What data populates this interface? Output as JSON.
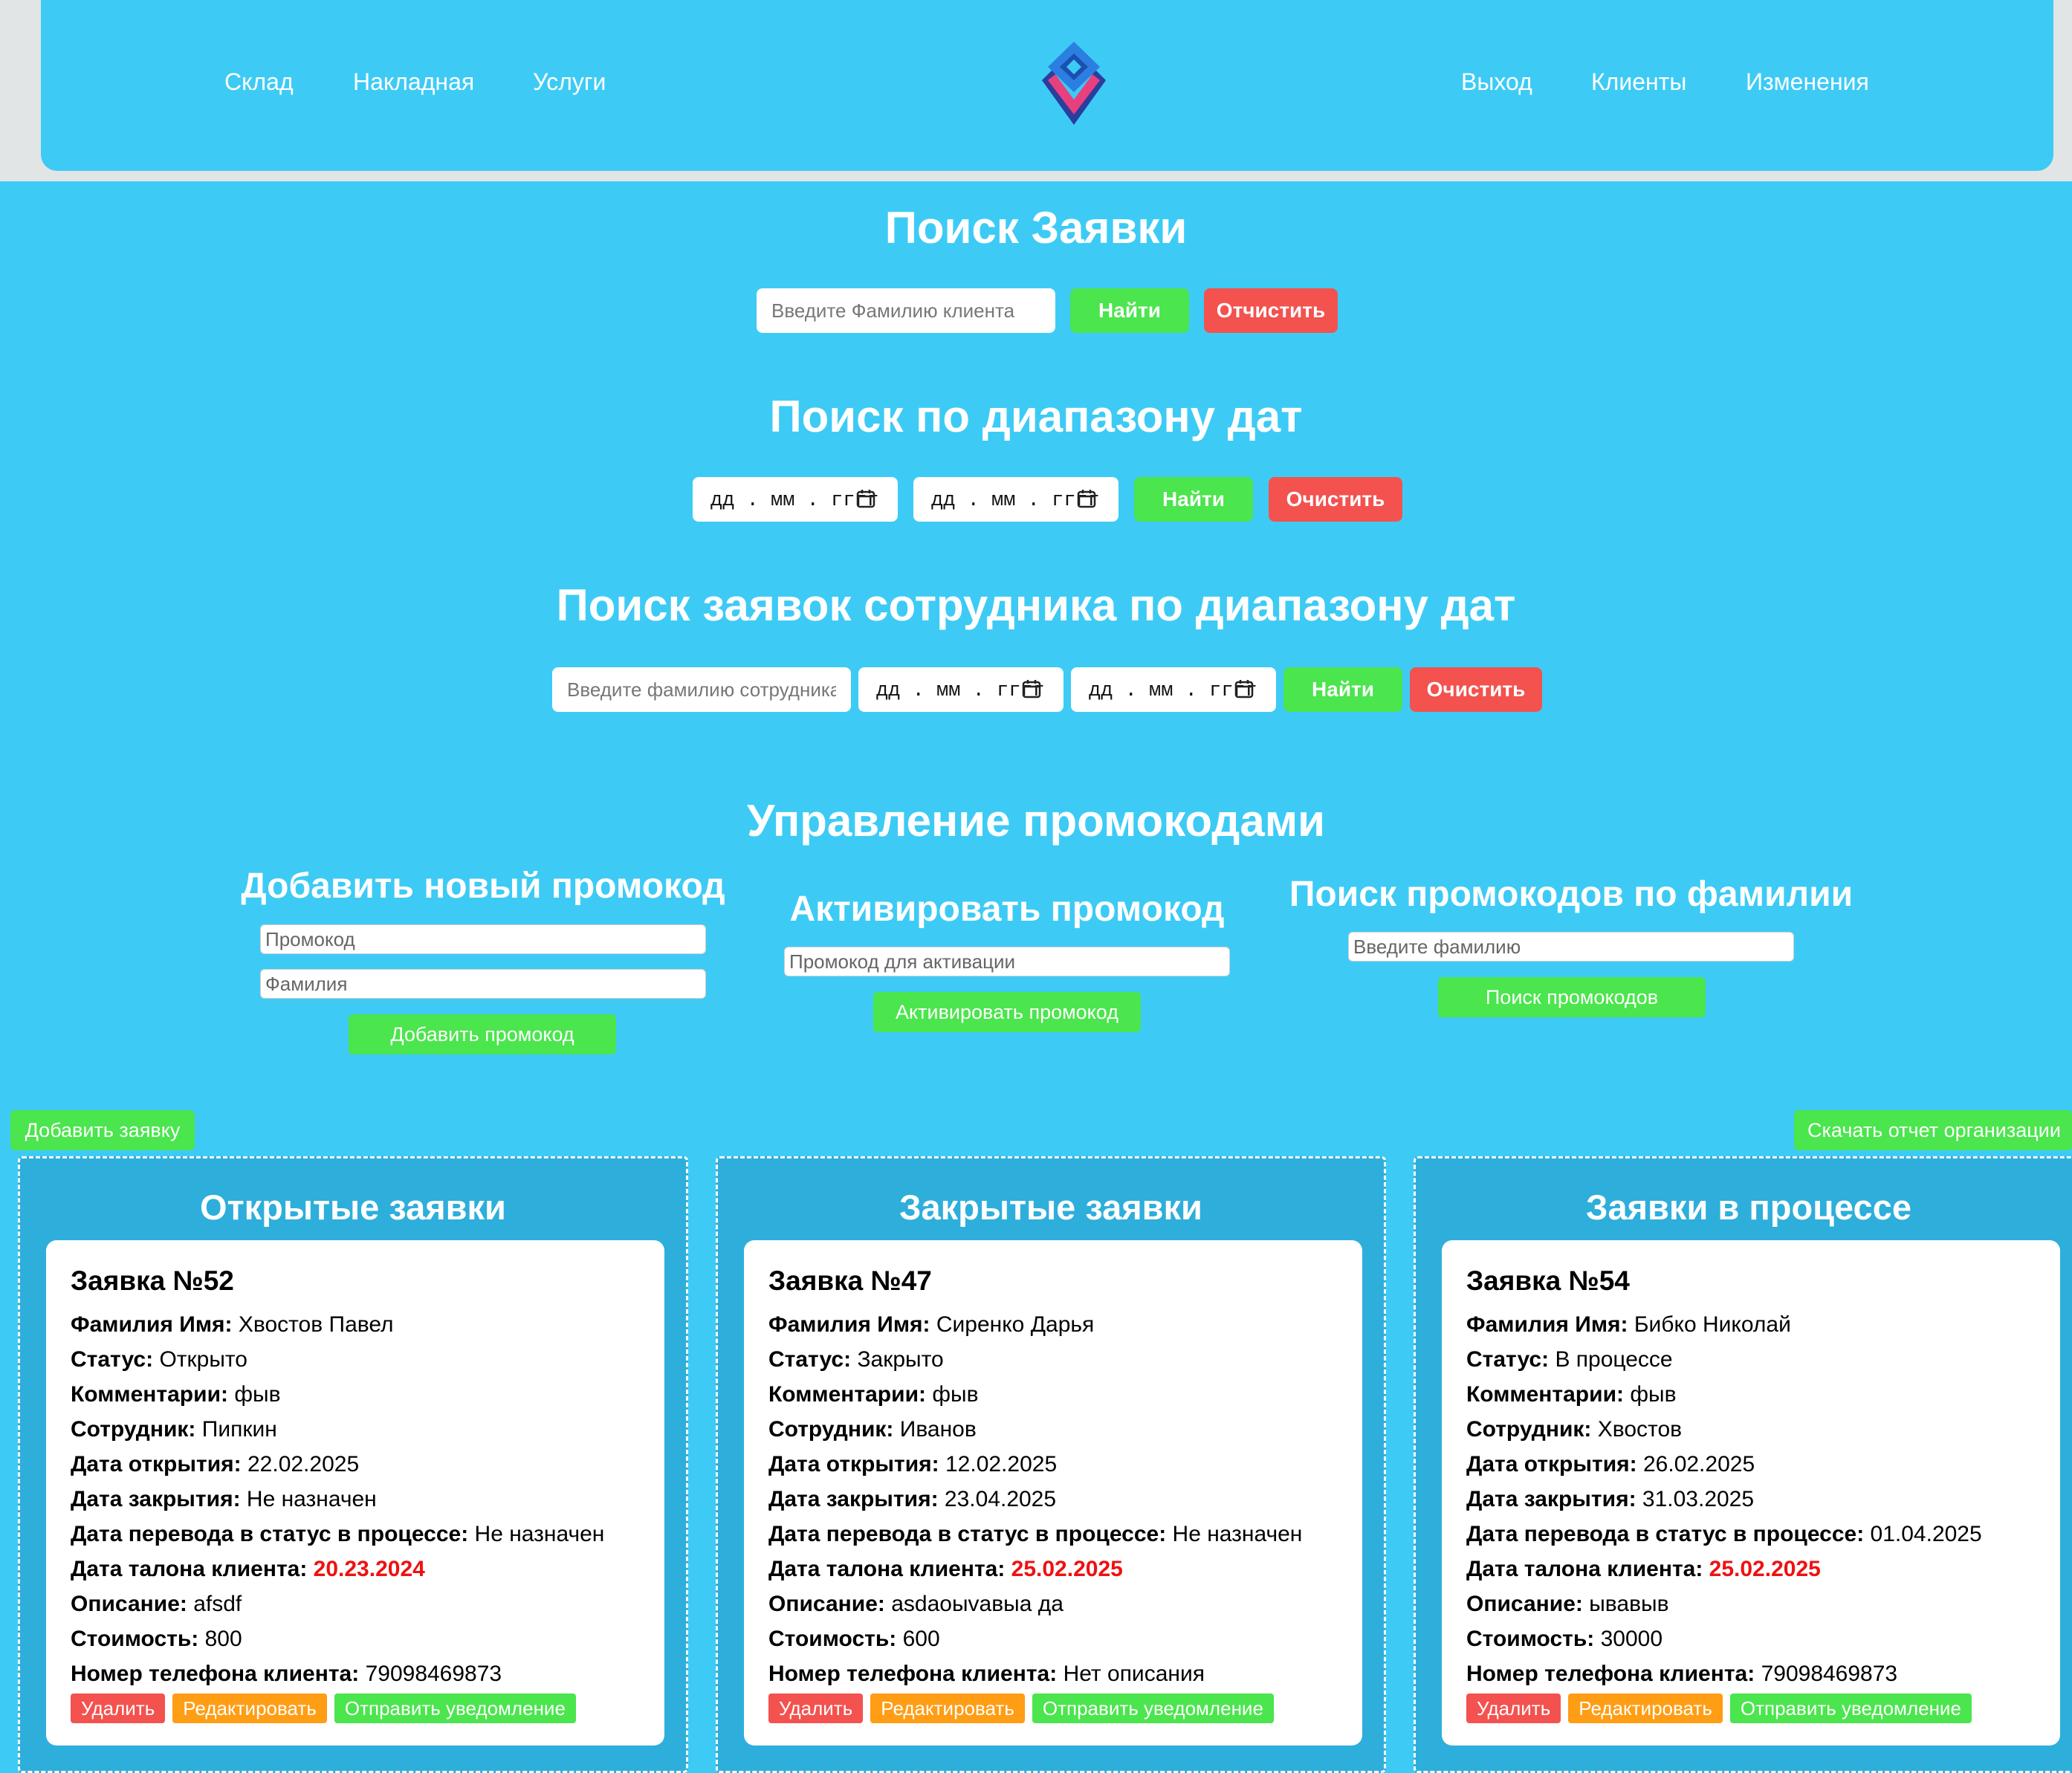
{
  "nav": {
    "left": [
      "Склад",
      "Накладная",
      "Услуги"
    ],
    "right": [
      "Выход",
      "Клиенты",
      "Изменения"
    ]
  },
  "search_request": {
    "title": "Поиск Заявки",
    "placeholder": "Введите Фамилию клиента",
    "find": "Найти",
    "clear": "Отчистить"
  },
  "search_dates": {
    "title": "Поиск по диапазону дат",
    "date_placeholder": "дд . мм . гггг",
    "find": "Найти",
    "clear": "Очистить"
  },
  "search_employee": {
    "title": "Поиск заявок сотрудника по диапазону дат",
    "placeholder": "Введите фамилию сотрудника",
    "date_placeholder": "дд . мм . гггг",
    "find": "Найти",
    "clear": "Очистить"
  },
  "promo": {
    "title": "Управление промокодами",
    "add": {
      "title": "Добавить новый промокод",
      "code_placeholder": "Промокод",
      "surname_placeholder": "Фамилия",
      "button": "Добавить промокод"
    },
    "activate": {
      "title": "Активировать промокод",
      "placeholder": "Промокод для активации",
      "button": "Активировать промокод"
    },
    "search": {
      "title": "Поиск промокодов по фамилии",
      "placeholder": "Введите фамилию",
      "button": "Поиск промокодов"
    }
  },
  "actions": {
    "add_request": "Добавить заявку",
    "download_report": "Скачать отчет организации"
  },
  "labels": {
    "name": "Фамилия Имя:",
    "status": "Статус:",
    "comments": "Комментарии:",
    "employee": "Сотрудник:",
    "opened": "Дата открытия:",
    "closed": "Дата закрытия:",
    "in_progress": "Дата перевода в статус в процессе:",
    "ticket": "Дата талона клиента:",
    "description": "Описание:",
    "cost": "Стоимость:",
    "phone": "Номер телефона клиента:",
    "delete": "Удалить",
    "edit": "Редактировать",
    "notify": "Отправить уведомление"
  },
  "columns": [
    {
      "title": "Открытые заявки",
      "card": {
        "title": "Заявка №52",
        "name": "Хвостов Павел",
        "status": "Открыто",
        "comments": "фыв",
        "employee": "Пипкин",
        "opened": "22.02.2025",
        "closed": "Не назначен",
        "in_progress": "Не назначен",
        "ticket": "20.23.2024",
        "description": "afsdf",
        "cost": "800",
        "phone": "79098469873"
      }
    },
    {
      "title": "Закрытые заявки",
      "card": {
        "title": "Заявка №47",
        "name": "Сиренко Дарья",
        "status": "Закрыто",
        "comments": "фыв",
        "employee": "Иванов",
        "opened": "12.02.2025",
        "closed": "23.04.2025",
        "in_progress": "Не назначен",
        "ticket": "25.02.2025",
        "description": "asdaoыvавыа да",
        "cost": "600",
        "phone": "Нет описания"
      }
    },
    {
      "title": "Заявки в процессе",
      "card": {
        "title": "Заявка №54",
        "name": "Бибко Николай",
        "status": "В процессе",
        "comments": "фыв",
        "employee": "Хвостов",
        "opened": "26.02.2025",
        "closed": "31.03.2025",
        "in_progress": "01.04.2025",
        "ticket": "25.02.2025",
        "description": "ывавыв",
        "cost": "30000",
        "phone": "79098469873"
      }
    }
  ]
}
